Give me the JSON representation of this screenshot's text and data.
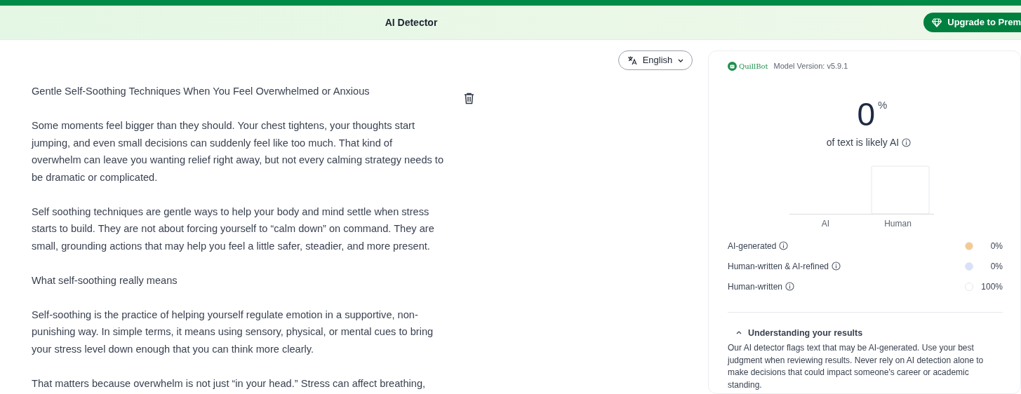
{
  "header": {
    "title": "AI Detector",
    "upgrade_button": "Upgrade to Prem"
  },
  "editor": {
    "language": "English",
    "paragraphs": [
      "Gentle Self-Soothing Techniques When You Feel Overwhelmed or Anxious",
      "Some moments feel bigger than they should. Your chest tightens, your thoughts start jumping, and even small decisions can suddenly feel like too much. That kind of overwhelm can leave you wanting relief right away, but not every calming strategy needs to be dramatic or complicated.",
      "Self soothing techniques are gentle ways to help your body and mind settle when stress starts to build. They are not about forcing yourself to “calm down” on command. They are small, grounding actions that may help you feel a little safer, steadier, and more present.",
      "What self-soothing really means",
      "Self-soothing is the practice of helping yourself regulate emotion in a supportive, non-punishing way. In simple terms, it means using sensory, physical, or mental cues to bring your stress level down enough that you can think more clearly.",
      "That matters because overwhelm is not just “in your head.” Stress can affect breathing,"
    ]
  },
  "results": {
    "brand": "QuillBot",
    "model_version": "Model Version: v5.9.1",
    "score": "0",
    "score_unit": "%",
    "score_caption": "of text is likely AI",
    "chart": {
      "categories": [
        "AI",
        "Human"
      ]
    },
    "legend": [
      {
        "label": "AI-generated",
        "color": "#f6c98d",
        "value": "0%"
      },
      {
        "label": "Human-written & AI-refined",
        "color": "#d7e1fb",
        "value": "0%"
      },
      {
        "label": "Human-written",
        "color": "#ffffff",
        "value": "100%"
      }
    ],
    "understanding": {
      "title": "Understanding your results",
      "expanded": true,
      "text": "Our AI detector flags text that may be AI-generated. Use your best judgment when reviewing results. Never rely on AI detection alone to make decisions that could impact someone's career or academic standing."
    }
  }
}
